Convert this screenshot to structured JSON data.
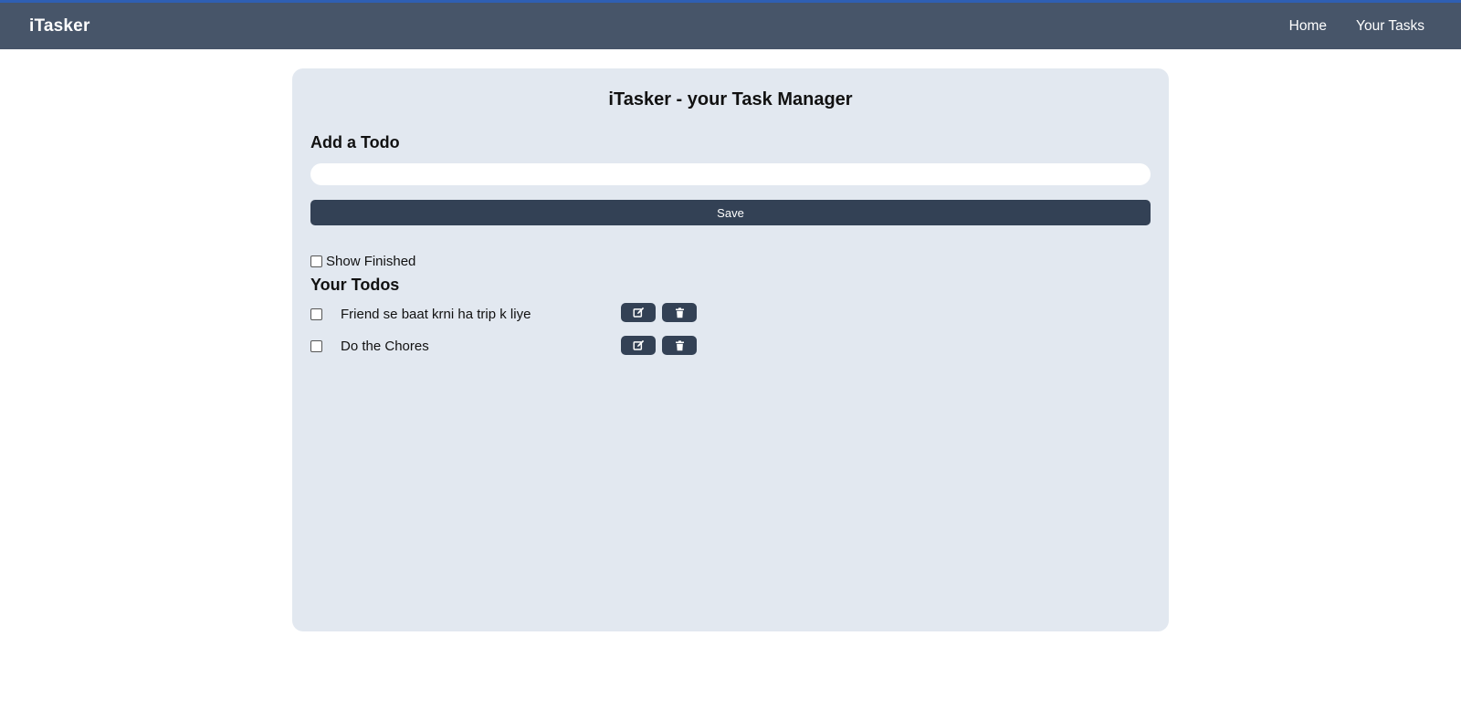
{
  "nav": {
    "brand": "iTasker",
    "links": [
      "Home",
      "Your Tasks"
    ]
  },
  "card": {
    "title": "iTasker - your Task Manager",
    "add_heading": "Add a Todo",
    "input_value": "",
    "save_label": "Save",
    "show_finished_label": "Show Finished",
    "show_finished_checked": false,
    "todos_heading": "Your Todos"
  },
  "todos": [
    {
      "text": "Friend se baat krni ha trip k liye",
      "done": false
    },
    {
      "text": "Do the Chores",
      "done": false
    }
  ],
  "icons": {
    "edit": "edit-icon",
    "delete": "trash-icon"
  },
  "colors": {
    "navbar": "#475569",
    "card": "#e2e8f0",
    "button": "#334155",
    "accent_line": "#2f5fb3"
  }
}
